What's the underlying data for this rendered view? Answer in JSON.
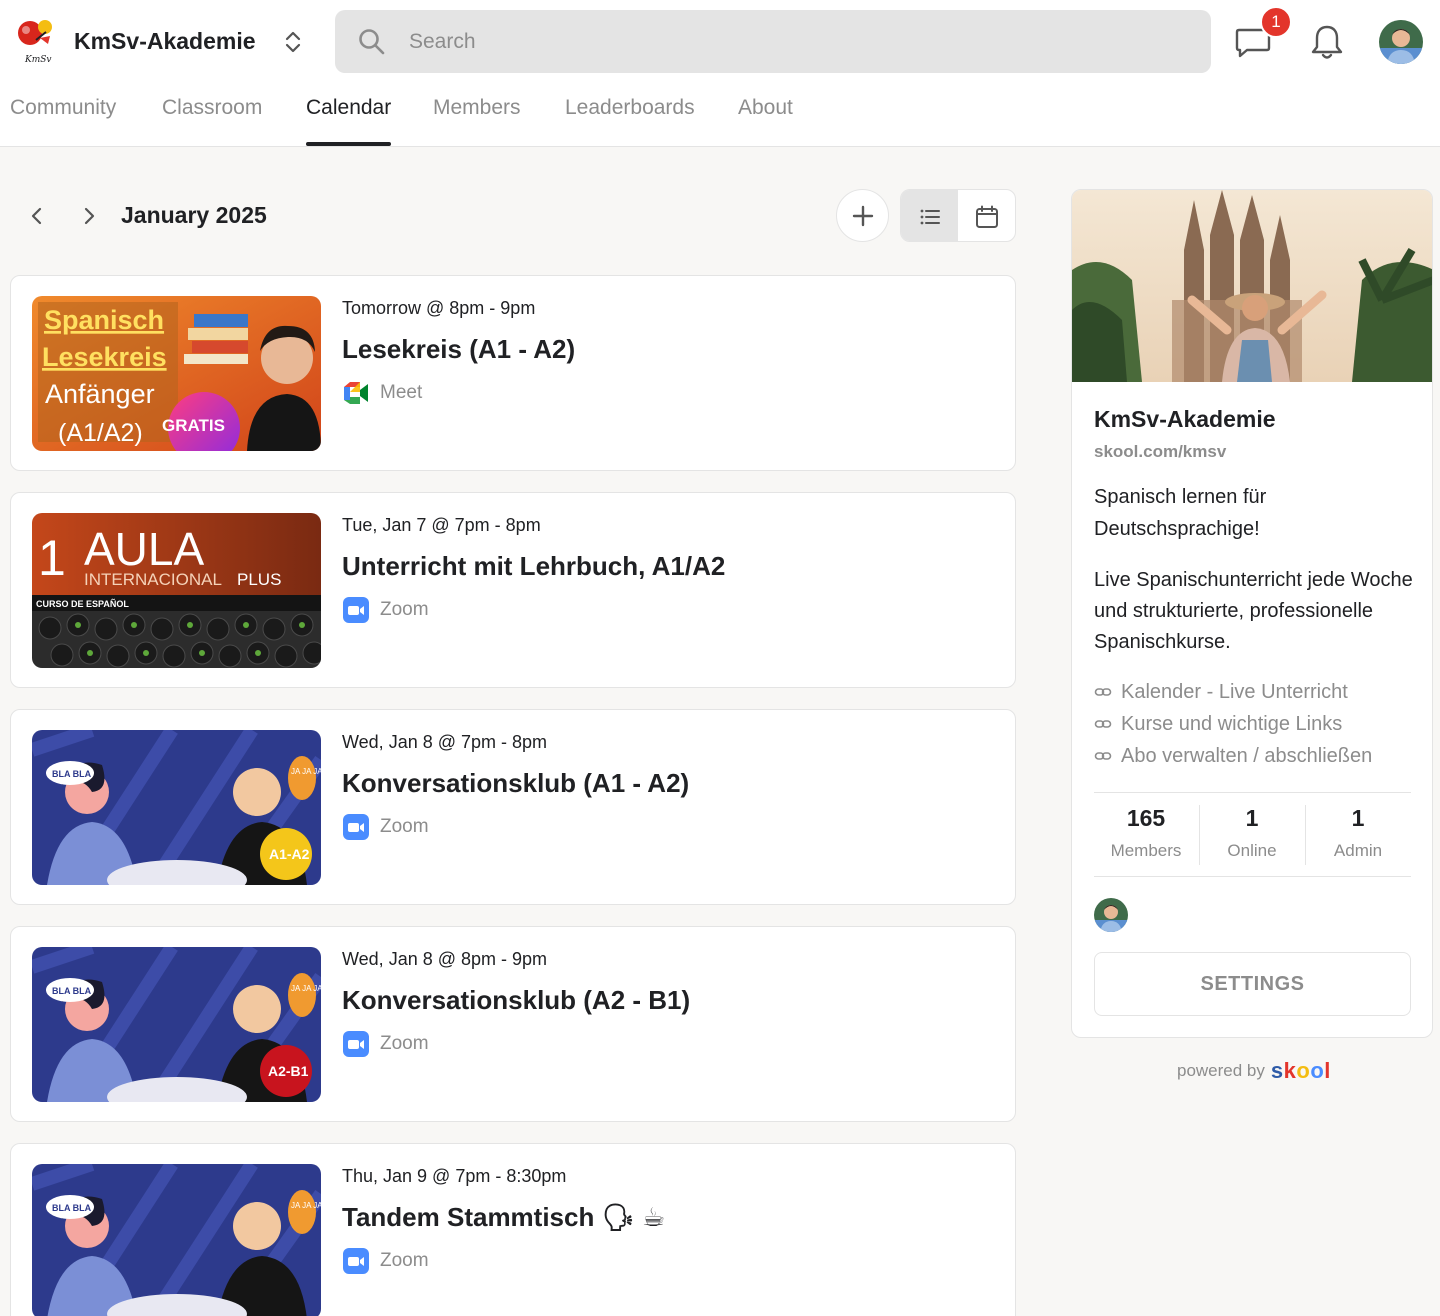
{
  "header": {
    "group_name": "KmSv-Akademie",
    "logo_text": "KmSv",
    "search_placeholder": "Search",
    "chat_unread_count": "1"
  },
  "nav": {
    "tabs": [
      {
        "label": "Community"
      },
      {
        "label": "Classroom"
      },
      {
        "label": "Calendar",
        "active": true
      },
      {
        "label": "Members"
      },
      {
        "label": "Leaderboards"
      },
      {
        "label": "About"
      }
    ]
  },
  "calendar": {
    "month_label": "January 2025",
    "view_active": "list"
  },
  "events": [
    {
      "time": "Tomorrow @ 8pm - 9pm",
      "title": "Lesekreis (A1 - A2)",
      "platform": "Meet",
      "thumb_lines": [
        "Spanisch",
        "Lesekreis",
        "Anfänger",
        "(A1/A2)"
      ],
      "thumb_badge": "GRATIS"
    },
    {
      "time": "Tue, Jan 7 @ 7pm - 8pm",
      "title": "Unterricht mit Lehrbuch, A1/A2",
      "platform": "Zoom",
      "thumb_number": "1",
      "thumb_title": "AULA",
      "thumb_subtitle_a": "INTERNACIONAL",
      "thumb_subtitle_b": "PLUS",
      "thumb_strip": "CURSO DE ESPAÑOL"
    },
    {
      "time": "Wed, Jan 8 @ 7pm - 8pm",
      "title": "Konversationsklub (A1 - A2)",
      "platform": "Zoom",
      "thumb_badge": "A1-A2",
      "thumb_bubble_left": "BLA BLA",
      "thumb_bubble_right": "JA JA JA"
    },
    {
      "time": "Wed, Jan 8 @ 8pm - 9pm",
      "title": "Konversationsklub (A2 - B1)",
      "platform": "Zoom",
      "thumb_badge": "A2-B1",
      "thumb_bubble_left": "BLA BLA",
      "thumb_bubble_right": "JA JA JA"
    },
    {
      "time": "Thu, Jan 9 @ 7pm - 8:30pm",
      "title": "Tandem Stammtisch 🗣 ☕",
      "platform": "Zoom",
      "thumb_bubble_left": "BLA BLA",
      "thumb_bubble_right": "JA JA JA"
    }
  ],
  "sidebar": {
    "name": "KmSv-Akademie",
    "url": "skool.com/kmsv",
    "tagline": "Spanisch lernen für Deutschsprachige!",
    "description": "Live Spanischunterricht jede Woche und strukturierte, professionelle Spanischkurse.",
    "links": [
      {
        "label": "Kalender - Live Unterricht"
      },
      {
        "label": "Kurse und wichtige Links"
      },
      {
        "label": "Abo verwalten / abschließen"
      }
    ],
    "stats": [
      {
        "value": "165",
        "label": "Members"
      },
      {
        "value": "1",
        "label": "Online"
      },
      {
        "value": "1",
        "label": "Admin"
      }
    ],
    "settings_label": "SETTINGS"
  },
  "footer": {
    "powered_by": "powered by",
    "skool_letters": [
      "s",
      "k",
      "o",
      "o",
      "l"
    ]
  },
  "colors": {
    "badge_red": "#e3352b",
    "zoom_blue": "#4a8cff",
    "text_primary": "#202124",
    "text_muted": "#8c8c8c",
    "skool_s": "#2e5ba8",
    "skool_k": "#e3352b",
    "skool_o1": "#f4bd12",
    "skool_o2": "#4a8cff",
    "skool_l": "#e3352b"
  }
}
